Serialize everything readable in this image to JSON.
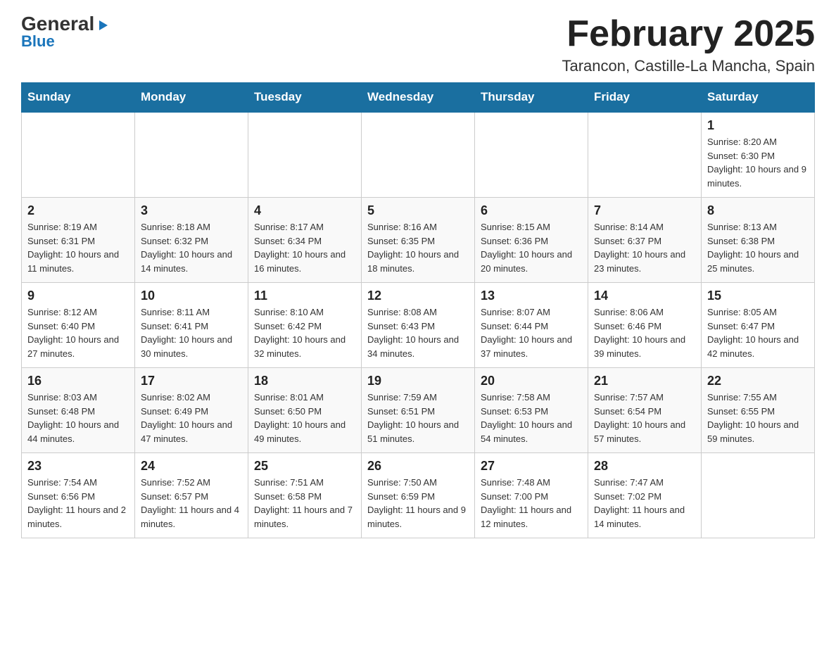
{
  "header": {
    "logo_general": "General",
    "logo_triangle": "▶",
    "logo_blue": "Blue",
    "month_title": "February 2025",
    "location": "Tarancon, Castille-La Mancha, Spain"
  },
  "calendar": {
    "days_of_week": [
      "Sunday",
      "Monday",
      "Tuesday",
      "Wednesday",
      "Thursday",
      "Friday",
      "Saturday"
    ],
    "weeks": [
      [
        {
          "day": "",
          "info": ""
        },
        {
          "day": "",
          "info": ""
        },
        {
          "day": "",
          "info": ""
        },
        {
          "day": "",
          "info": ""
        },
        {
          "day": "",
          "info": ""
        },
        {
          "day": "",
          "info": ""
        },
        {
          "day": "1",
          "info": "Sunrise: 8:20 AM\nSunset: 6:30 PM\nDaylight: 10 hours and 9 minutes."
        }
      ],
      [
        {
          "day": "2",
          "info": "Sunrise: 8:19 AM\nSunset: 6:31 PM\nDaylight: 10 hours and 11 minutes."
        },
        {
          "day": "3",
          "info": "Sunrise: 8:18 AM\nSunset: 6:32 PM\nDaylight: 10 hours and 14 minutes."
        },
        {
          "day": "4",
          "info": "Sunrise: 8:17 AM\nSunset: 6:34 PM\nDaylight: 10 hours and 16 minutes."
        },
        {
          "day": "5",
          "info": "Sunrise: 8:16 AM\nSunset: 6:35 PM\nDaylight: 10 hours and 18 minutes."
        },
        {
          "day": "6",
          "info": "Sunrise: 8:15 AM\nSunset: 6:36 PM\nDaylight: 10 hours and 20 minutes."
        },
        {
          "day": "7",
          "info": "Sunrise: 8:14 AM\nSunset: 6:37 PM\nDaylight: 10 hours and 23 minutes."
        },
        {
          "day": "8",
          "info": "Sunrise: 8:13 AM\nSunset: 6:38 PM\nDaylight: 10 hours and 25 minutes."
        }
      ],
      [
        {
          "day": "9",
          "info": "Sunrise: 8:12 AM\nSunset: 6:40 PM\nDaylight: 10 hours and 27 minutes."
        },
        {
          "day": "10",
          "info": "Sunrise: 8:11 AM\nSunset: 6:41 PM\nDaylight: 10 hours and 30 minutes."
        },
        {
          "day": "11",
          "info": "Sunrise: 8:10 AM\nSunset: 6:42 PM\nDaylight: 10 hours and 32 minutes."
        },
        {
          "day": "12",
          "info": "Sunrise: 8:08 AM\nSunset: 6:43 PM\nDaylight: 10 hours and 34 minutes."
        },
        {
          "day": "13",
          "info": "Sunrise: 8:07 AM\nSunset: 6:44 PM\nDaylight: 10 hours and 37 minutes."
        },
        {
          "day": "14",
          "info": "Sunrise: 8:06 AM\nSunset: 6:46 PM\nDaylight: 10 hours and 39 minutes."
        },
        {
          "day": "15",
          "info": "Sunrise: 8:05 AM\nSunset: 6:47 PM\nDaylight: 10 hours and 42 minutes."
        }
      ],
      [
        {
          "day": "16",
          "info": "Sunrise: 8:03 AM\nSunset: 6:48 PM\nDaylight: 10 hours and 44 minutes."
        },
        {
          "day": "17",
          "info": "Sunrise: 8:02 AM\nSunset: 6:49 PM\nDaylight: 10 hours and 47 minutes."
        },
        {
          "day": "18",
          "info": "Sunrise: 8:01 AM\nSunset: 6:50 PM\nDaylight: 10 hours and 49 minutes."
        },
        {
          "day": "19",
          "info": "Sunrise: 7:59 AM\nSunset: 6:51 PM\nDaylight: 10 hours and 51 minutes."
        },
        {
          "day": "20",
          "info": "Sunrise: 7:58 AM\nSunset: 6:53 PM\nDaylight: 10 hours and 54 minutes."
        },
        {
          "day": "21",
          "info": "Sunrise: 7:57 AM\nSunset: 6:54 PM\nDaylight: 10 hours and 57 minutes."
        },
        {
          "day": "22",
          "info": "Sunrise: 7:55 AM\nSunset: 6:55 PM\nDaylight: 10 hours and 59 minutes."
        }
      ],
      [
        {
          "day": "23",
          "info": "Sunrise: 7:54 AM\nSunset: 6:56 PM\nDaylight: 11 hours and 2 minutes."
        },
        {
          "day": "24",
          "info": "Sunrise: 7:52 AM\nSunset: 6:57 PM\nDaylight: 11 hours and 4 minutes."
        },
        {
          "day": "25",
          "info": "Sunrise: 7:51 AM\nSunset: 6:58 PM\nDaylight: 11 hours and 7 minutes."
        },
        {
          "day": "26",
          "info": "Sunrise: 7:50 AM\nSunset: 6:59 PM\nDaylight: 11 hours and 9 minutes."
        },
        {
          "day": "27",
          "info": "Sunrise: 7:48 AM\nSunset: 7:00 PM\nDaylight: 11 hours and 12 minutes."
        },
        {
          "day": "28",
          "info": "Sunrise: 7:47 AM\nSunset: 7:02 PM\nDaylight: 11 hours and 14 minutes."
        },
        {
          "day": "",
          "info": ""
        }
      ]
    ]
  }
}
